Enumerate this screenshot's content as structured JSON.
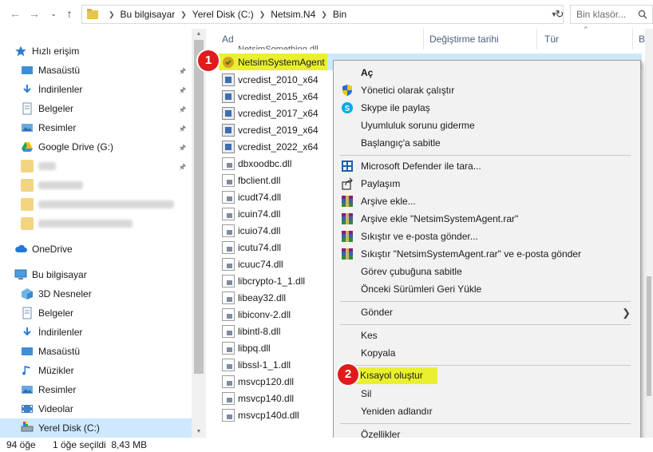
{
  "address_bar": {
    "path": [
      "Bu bilgisayar",
      "Yerel Disk (C:)",
      "Netsim.N4",
      "Bin"
    ],
    "search_placeholder": "Bin klasör..."
  },
  "columns": {
    "name": "Ad",
    "date": "Değiştirme tarihi",
    "type": "Tür",
    "size": "B"
  },
  "sidebar": {
    "quick_access": "Hızlı erişim",
    "quick_items": [
      "Masaüstü",
      "İndirilenler",
      "Belgeler",
      "Resimler",
      "Google Drive (G:)"
    ],
    "onedrive": "OneDrive",
    "this_pc": "Bu bilgisayar",
    "pc_items": [
      "3D Nesneler",
      "Belgeler",
      "İndirilenler",
      "Masaüstü",
      "Müzikler",
      "Resimler",
      "Videolar",
      "Yerel Disk (C:)"
    ]
  },
  "files": [
    "NetsimSystemAgent",
    "vcredist_2010_x64",
    "vcredist_2015_x64",
    "vcredist_2017_x64",
    "vcredist_2019_x64",
    "vcredist_2022_x64",
    "dbxoodbc.dll",
    "fbclient.dll",
    "icudt74.dll",
    "icuin74.dll",
    "icuio74.dll",
    "icutu74.dll",
    "icuuc74.dll",
    "libcrypto-1_1.dll",
    "libeay32.dll",
    "libiconv-2.dll",
    "libintl-8.dll",
    "libpq.dll",
    "libssl-1_1.dll",
    "msvcp120.dll",
    "msvcp140.dll",
    "msvcp140d.dll"
  ],
  "context_menu": {
    "open": "Aç",
    "run_admin": "Yönetici olarak çalıştır",
    "skype_share": "Skype ile paylaş",
    "troubleshoot": "Uyumluluk sorunu giderme",
    "pin_start": "Başlangıç'a sabitle",
    "defender": "Microsoft Defender ile tara...",
    "share": "Paylaşım",
    "add_archive": "Arşive ekle...",
    "add_rar": "Arşive ekle \"NetsimSystemAgent.rar\"",
    "compress_email": "Sıkıştır ve e-posta gönder...",
    "compress_rar_email": "Sıkıştır \"NetsimSystemAgent.rar\" ve e-posta gönder",
    "pin_taskbar": "Görev çubuğuna sabitle",
    "restore_prev": "Önceki Sürümleri Geri Yükle",
    "send_to": "Gönder",
    "cut": "Kes",
    "copy": "Kopyala",
    "create_shortcut": "Kısayol oluştur",
    "delete": "Sil",
    "rename": "Yeniden adlandır",
    "properties": "Özellikler"
  },
  "badges": {
    "step1": "1",
    "step2": "2"
  },
  "status": {
    "count": "94 öğe",
    "selected": "1 öğe seçildi  8,43 MB"
  },
  "colors": {
    "highlight": "#eaf030",
    "badge": "#e01b1b",
    "selection": "#cce8ff"
  }
}
